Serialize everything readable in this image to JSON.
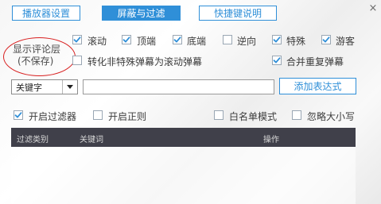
{
  "tabs": [
    {
      "label": "播放器设置"
    },
    {
      "label": "屏蔽与过滤"
    },
    {
      "label": "快捷键说明"
    }
  ],
  "close_label": "×",
  "layer_label": {
    "line1": "显示评论层",
    "line2": "(不保存)"
  },
  "layer_checkboxes": [
    {
      "label": "滚动",
      "checked": true
    },
    {
      "label": "顶端",
      "checked": true
    },
    {
      "label": "底端",
      "checked": true
    },
    {
      "label": "逆向",
      "checked": false
    },
    {
      "label": "特殊",
      "checked": true
    },
    {
      "label": "游客",
      "checked": true
    }
  ],
  "convert_option": {
    "label": "转化非特殊弹幕为滚动弹幕",
    "checked": false
  },
  "merge_option": {
    "label": "合并重复弹幕",
    "checked": true
  },
  "filter": {
    "type_value": "关键字",
    "input_value": "",
    "add_button": "添加表达式"
  },
  "filter_options": [
    {
      "label": "开启过滤器",
      "checked": true
    },
    {
      "label": "开启正则",
      "checked": false
    },
    {
      "label": "白名单模式",
      "checked": false
    },
    {
      "label": "忽略大小写",
      "checked": false
    }
  ],
  "table": {
    "columns": [
      "过滤类别",
      "关键词",
      "操作"
    ],
    "rows": []
  },
  "colors": {
    "accent": "#2f8fd8",
    "header_bg": "#40404a",
    "annotation": "#d81e1e"
  }
}
